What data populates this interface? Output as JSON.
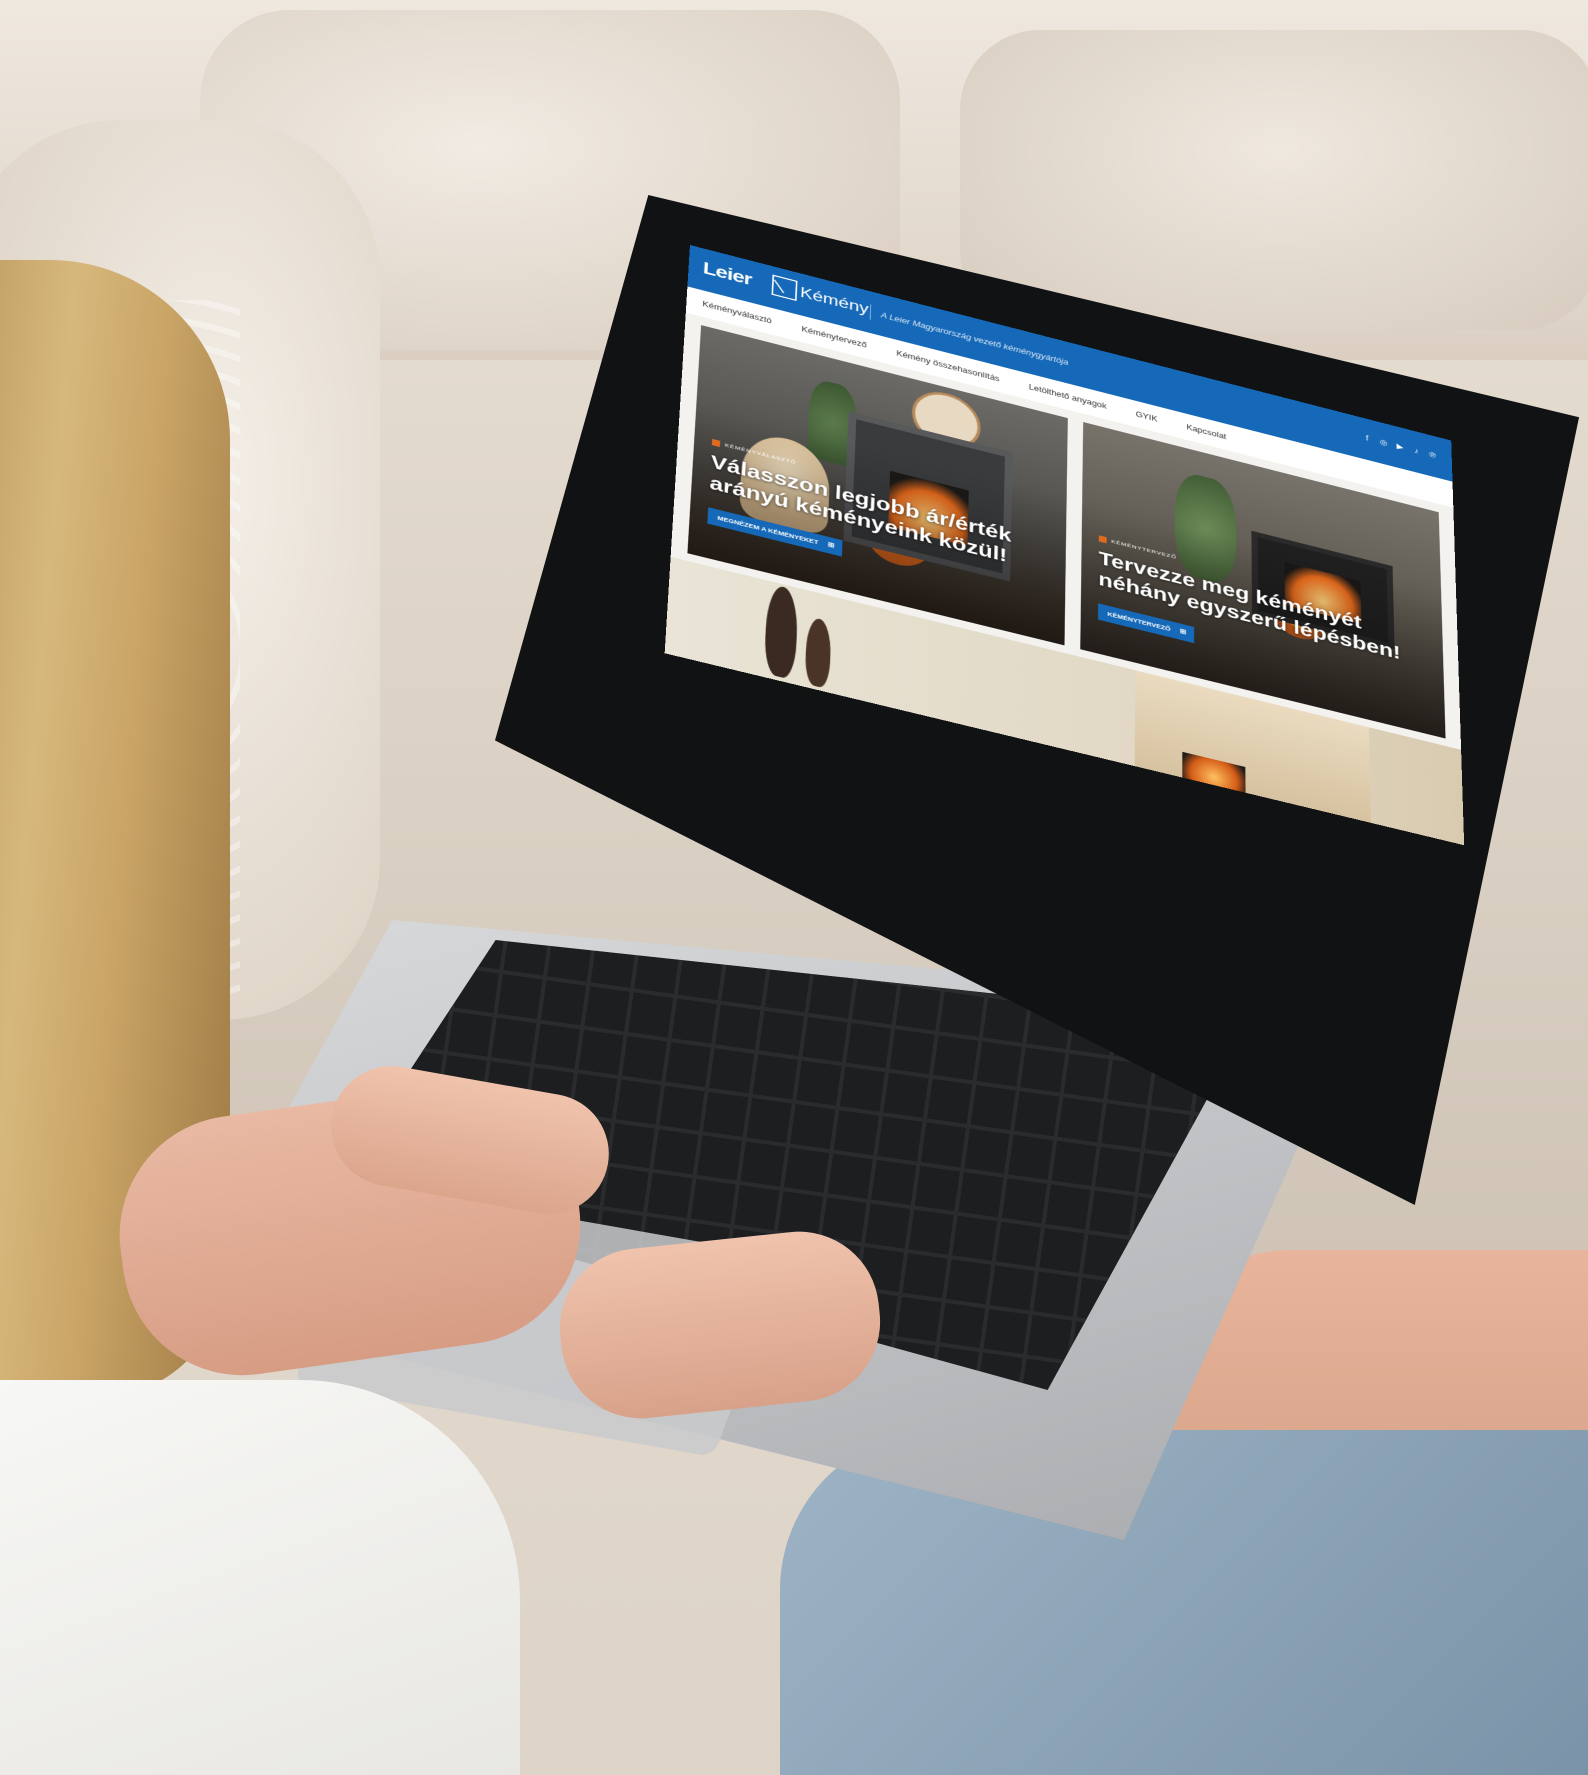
{
  "site": {
    "logo_word": "Leier",
    "logo_name": "Kémény",
    "tagline": "A Leier Magyarország vezető kéménygyártója",
    "social_icons": [
      "facebook-icon",
      "instagram-icon",
      "youtube-icon",
      "tiktok-icon",
      "pinterest-icon"
    ],
    "social_glyphs": [
      "f",
      "◎",
      "▶",
      "♪",
      "℗"
    ],
    "nav": [
      "Kéményválasztó",
      "Kéménytervező",
      "Kémény összehasonlítás",
      "Letölthető anyagok",
      "GYIK",
      "Kapcsolat"
    ],
    "hero_1": {
      "kicker": "KÉMÉNYVÁLASZTÓ",
      "headline": "Válasszon legjobb ár/érték arányú kéményeink közül!",
      "cta": "MEGNÉZEM A KÉMÉNYEKET"
    },
    "hero_2": {
      "kicker": "KÉMÉNYTERVEZŐ",
      "headline": "Tervezze meg kéményét néhány egyszerű lépésben!",
      "cta": "KÉMÉNYTERVEZŐ"
    },
    "colors": {
      "brand_blue": "#1569b8",
      "accent_orange": "#e06b1f"
    }
  }
}
